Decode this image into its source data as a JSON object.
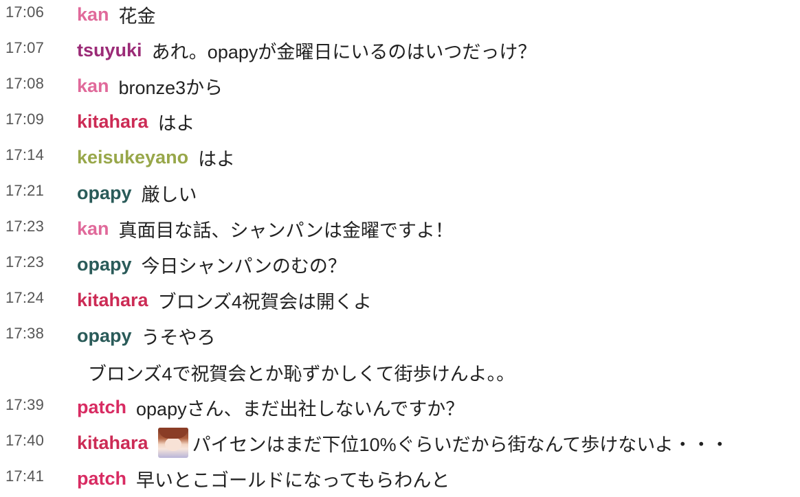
{
  "colors": {
    "kan": "#e0699a",
    "tsuyuki": "#9b2b77",
    "kitahara": "#cc2b55",
    "keisukeyano": "#98a74a",
    "opapy": "#2a5b59",
    "patch": "#d82b62"
  },
  "messages": [
    {
      "time": "17:06",
      "user": "kan",
      "text": "花金"
    },
    {
      "time": "17:07",
      "user": "tsuyuki",
      "text": "あれ。opapyが金曜日にいるのはいつだっけ？"
    },
    {
      "time": "17:08",
      "user": "kan",
      "text": "bronze3から"
    },
    {
      "time": "17:09",
      "user": "kitahara",
      "text": "はよ"
    },
    {
      "time": "17:14",
      "user": "keisukeyano",
      "text": "はよ"
    },
    {
      "time": "17:21",
      "user": "opapy",
      "text": "厳しい"
    },
    {
      "time": "17:23",
      "user": "kan",
      "text": "真面目な話、シャンパンは金曜ですよ！"
    },
    {
      "time": "17:23",
      "user": "opapy",
      "text": "今日シャンパンのむの？"
    },
    {
      "time": "17:24",
      "user": "kitahara",
      "text": "ブロンズ4祝賀会は開くよ"
    },
    {
      "time": "17:38",
      "user": "opapy",
      "text": "うそやろ"
    },
    {
      "text": "ブロンズ4で祝賀会とか恥ずかしくて街歩けんよ。。"
    },
    {
      "time": "17:39",
      "user": "patch",
      "text": "opapyさん、まだ出社しないんですか？"
    },
    {
      "time": "17:40",
      "user": "kitahara",
      "text": "パイセンはまだ下位10%ぐらいだから街なんて歩けないよ・・・"
    },
    {
      "time": "17:41",
      "user": "patch",
      "text": "早いとこゴールドになってもらわんと"
    }
  ]
}
